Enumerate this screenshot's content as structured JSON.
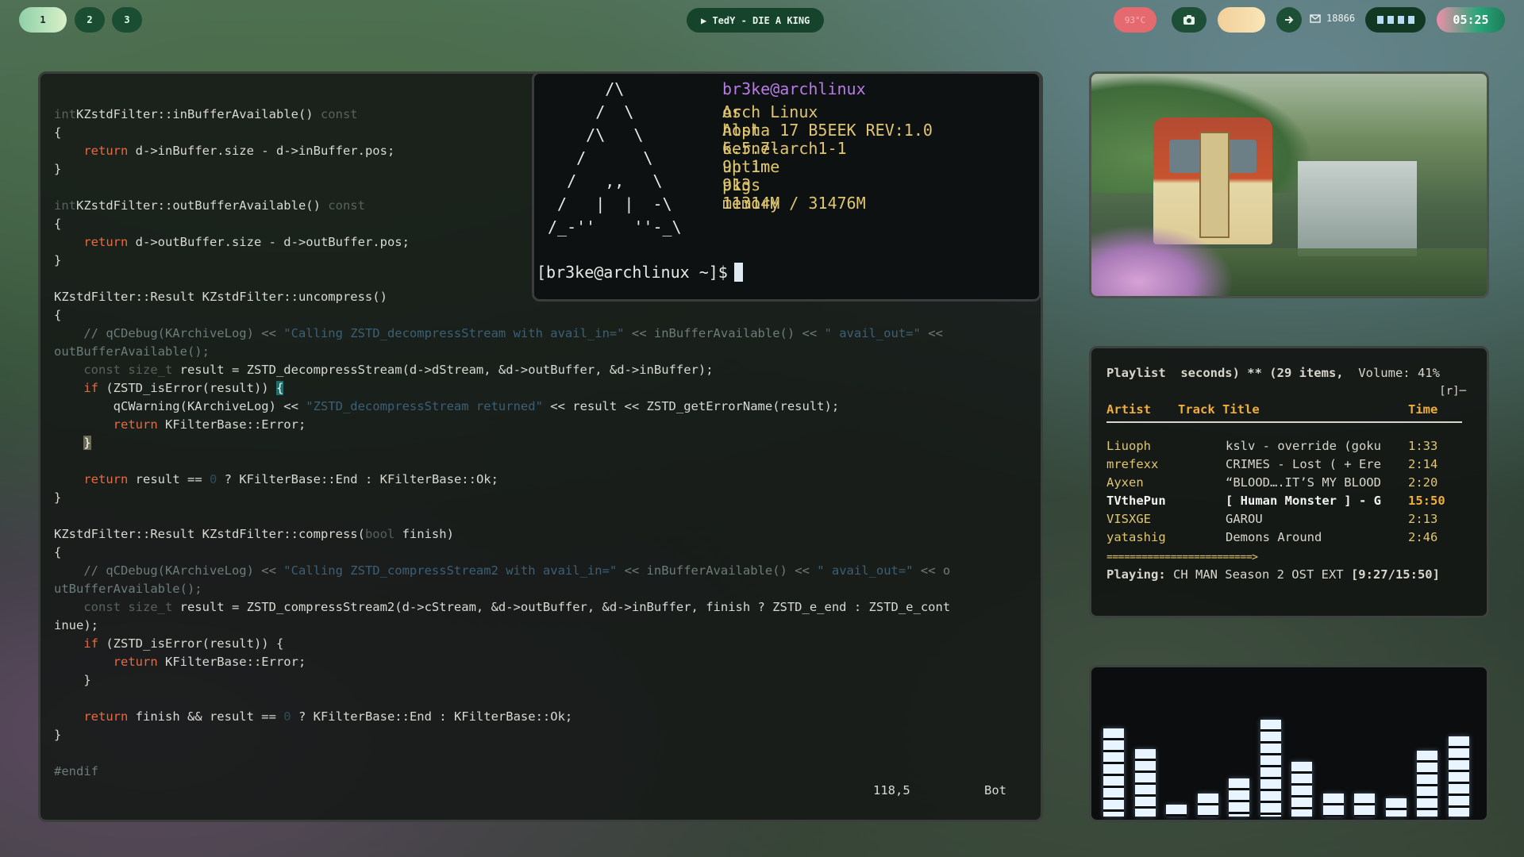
{
  "topbar": {
    "workspaces": [
      "1",
      "2",
      "3"
    ],
    "now_playing": "▶ TedY - DIE A KING",
    "temperature": "93°C",
    "mail_count": "18866",
    "clock": "05:25"
  },
  "editor": {
    "lines": [
      {
        "parts": [
          [
            "t",
            "int"
          ],
          [
            "",
            "KZstdFilter::inBufferAvailable() "
          ],
          [
            "t",
            "const"
          ]
        ]
      },
      {
        "parts": [
          [
            "",
            "{"
          ]
        ]
      },
      {
        "parts": [
          [
            "",
            "    "
          ],
          [
            "k",
            "return"
          ],
          [
            "",
            " d->inBuffer.size - d->inBuffer.pos;"
          ]
        ]
      },
      {
        "parts": [
          [
            "",
            "}"
          ]
        ]
      },
      {
        "parts": [
          [
            "",
            ""
          ]
        ]
      },
      {
        "parts": [
          [
            "t",
            "int"
          ],
          [
            "",
            "KZstdFilter::outBufferAvailable() "
          ],
          [
            "t",
            "const"
          ]
        ]
      },
      {
        "parts": [
          [
            "",
            "{"
          ]
        ]
      },
      {
        "parts": [
          [
            "",
            "    "
          ],
          [
            "k",
            "return"
          ],
          [
            "",
            " d->outBuffer.size - d->outBuffer.pos;"
          ]
        ]
      },
      {
        "parts": [
          [
            "",
            "}"
          ]
        ]
      },
      {
        "parts": [
          [
            "",
            ""
          ]
        ]
      },
      {
        "parts": [
          [
            "",
            "KZstdFilter::Result KZstdFilter::uncompress()"
          ]
        ]
      },
      {
        "parts": [
          [
            "",
            "{"
          ]
        ]
      },
      {
        "parts": [
          [
            "",
            "    "
          ],
          [
            "c",
            "// qCDebug(KArchiveLog) << "
          ],
          [
            "s",
            "\"Calling ZSTD_decompressStream with avail_in=\""
          ],
          [
            "c",
            " << inBufferAvailable() << "
          ],
          [
            "s",
            "\" avail_out=\""
          ],
          [
            "c",
            " <<"
          ]
        ]
      },
      {
        "parts": [
          [
            "c",
            "outBufferAvailable();"
          ]
        ]
      },
      {
        "parts": [
          [
            "",
            "    "
          ],
          [
            "t",
            "const size_t"
          ],
          [
            "",
            " result = ZSTD_decompressStream(d->dStream, &d->outBuffer, &d->inBuffer);"
          ]
        ]
      },
      {
        "parts": [
          [
            "",
            "    "
          ],
          [
            "k",
            "if"
          ],
          [
            "",
            " (ZSTD_isError(result)) "
          ],
          [
            "cur",
            "{"
          ]
        ]
      },
      {
        "parts": [
          [
            "",
            "        qCWarning(KArchiveLog) << "
          ],
          [
            "s",
            "\"ZSTD_decompressStream returned\""
          ],
          [
            "",
            " << result << ZSTD_getErrorName(result);"
          ]
        ]
      },
      {
        "parts": [
          [
            "",
            "        "
          ],
          [
            "k",
            "return"
          ],
          [
            "",
            " KFilterBase::Error;"
          ]
        ]
      },
      {
        "parts": [
          [
            "",
            "    "
          ],
          [
            "cur2",
            "}"
          ]
        ]
      },
      {
        "parts": [
          [
            "",
            ""
          ]
        ]
      },
      {
        "parts": [
          [
            "",
            "    "
          ],
          [
            "k",
            "return"
          ],
          [
            "",
            " result == "
          ],
          [
            "n",
            "0"
          ],
          [
            "",
            " ? KFilterBase::End : KFilterBase::Ok;"
          ]
        ]
      },
      {
        "parts": [
          [
            "",
            "}"
          ]
        ]
      },
      {
        "parts": [
          [
            "",
            ""
          ]
        ]
      },
      {
        "parts": [
          [
            "",
            "KZstdFilter::Result KZstdFilter::compress("
          ],
          [
            "t",
            "bool"
          ],
          [
            "",
            " finish)"
          ]
        ]
      },
      {
        "parts": [
          [
            "",
            "{"
          ]
        ]
      },
      {
        "parts": [
          [
            "",
            "    "
          ],
          [
            "c",
            "// qCDebug(KArchiveLog) << "
          ],
          [
            "s",
            "\"Calling ZSTD_compressStream2 with avail_in=\""
          ],
          [
            "c",
            " << inBufferAvailable() << "
          ],
          [
            "s",
            "\" avail_out=\""
          ],
          [
            "c",
            " << o"
          ]
        ]
      },
      {
        "parts": [
          [
            "c",
            "utBufferAvailable();"
          ]
        ]
      },
      {
        "parts": [
          [
            "",
            "    "
          ],
          [
            "t",
            "const size_t"
          ],
          [
            "",
            " result = ZSTD_compressStream2(d->cStream, &d->outBuffer, &d->inBuffer, finish ? ZSTD_e_end : ZSTD_e_cont"
          ]
        ]
      },
      {
        "parts": [
          [
            "",
            "inue);"
          ]
        ]
      },
      {
        "parts": [
          [
            "",
            "    "
          ],
          [
            "k",
            "if"
          ],
          [
            "",
            " (ZSTD_isError(result)) {"
          ]
        ]
      },
      {
        "parts": [
          [
            "",
            "        "
          ],
          [
            "k",
            "return"
          ],
          [
            "",
            " KFilterBase::Error;"
          ]
        ]
      },
      {
        "parts": [
          [
            "",
            "    }"
          ]
        ]
      },
      {
        "parts": [
          [
            "",
            ""
          ]
        ]
      },
      {
        "parts": [
          [
            "",
            "    "
          ],
          [
            "k",
            "return"
          ],
          [
            "",
            " finish && result == "
          ],
          [
            "n",
            "0"
          ],
          [
            "",
            " ? KFilterBase::End : KFilterBase::Ok;"
          ]
        ]
      },
      {
        "parts": [
          [
            "",
            "}"
          ]
        ]
      },
      {
        "parts": [
          [
            "",
            ""
          ]
        ]
      },
      {
        "parts": [
          [
            "c",
            "#endif"
          ]
        ]
      }
    ],
    "status_position": "118,5",
    "status_scroll": "Bot"
  },
  "terminal": {
    "logo": "      /\\\n     /  \\\n    /\\   \\\n   /      \\\n  /   ,,   \\\n /   |  |  -\\\n/_-''    ''-_\\",
    "title": "br3ke@archlinux",
    "info": [
      {
        "label": "os",
        "value": "Arch Linux"
      },
      {
        "label": "host",
        "value": "Alpha 17 B5EEK REV:1.0"
      },
      {
        "label": "kernel",
        "value": "6.5.7-arch1-1"
      },
      {
        "label": "uptime",
        "value": "9h 1m"
      },
      {
        "label": "pkgs",
        "value": "913"
      },
      {
        "label": "memory",
        "value": "11314M / 31476M"
      }
    ],
    "prompt": "[br3ke@archlinux ~]$"
  },
  "playlist": {
    "header": "Playlist  seconds) ** (29 items,",
    "volume": "Volume: 41%",
    "repeat": "[r]─",
    "columns": {
      "artist": "Artist",
      "title": "Track Title",
      "time": "Time"
    },
    "tracks": [
      {
        "artist": "Liuoph",
        "title": "kslv - override (goku",
        "time": "1:33",
        "active": false
      },
      {
        "artist": "mrefexx",
        "title": "CRIMES - Lost ( + Ere",
        "time": "2:14",
        "active": false
      },
      {
        "artist": "Ayxen",
        "title": "“BLOOD….IT’S MY BLOOD",
        "time": "2:20",
        "active": false
      },
      {
        "artist": "TVthePun",
        "title": "[ Human Monster ] - G",
        "time": "15:50",
        "active": true
      },
      {
        "artist": "VISXGE",
        "title": "GAROU",
        "time": "2:13",
        "active": false
      },
      {
        "artist": "yatashig",
        "title": "Demons Around",
        "time": "2:46",
        "active": false
      }
    ],
    "separator": "=========================>",
    "playing_label": "Playing:",
    "playing_text": " CH MAN Season 2 OST EXT ",
    "playing_time": "[9:27/15:50]"
  },
  "visualizer": {
    "levels": [
      0.74,
      0.57,
      0.1,
      0.19,
      0.32,
      0.81,
      0.46,
      0.19,
      0.19,
      0.15,
      0.55,
      0.67
    ]
  }
}
